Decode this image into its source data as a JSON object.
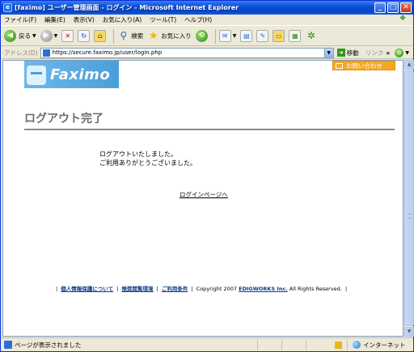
{
  "window": {
    "title": "[faximo] ユーザー管理画面 - ログイン - Microsoft Internet Explorer",
    "app_icon": "ie-icon",
    "controls": [
      "minimize",
      "maximize",
      "close"
    ]
  },
  "menu": {
    "items": [
      "ファイル(F)",
      "編集(E)",
      "表示(V)",
      "お気に入り(A)",
      "ツール(T)",
      "ヘルプ(H)"
    ]
  },
  "toolbar": {
    "back_label": "戻る",
    "search_label": "検索",
    "favorites_label": "お気に入り"
  },
  "address": {
    "label": "アドレス(D)",
    "url": "https://secure.faximo.jp/user/login.php",
    "go_label": "移動",
    "links_label": "リンク",
    "chevron": "»"
  },
  "page": {
    "logo_text": "Faximo",
    "contact_label": "お問い合わせ",
    "heading": "ログアウト完了",
    "message_line1": "ログアウトいたしました。",
    "message_line2": "ご利用ありがとうございました。",
    "login_link": "ログインページへ",
    "footer": {
      "privacy": "個人情報保護について",
      "browser": "推奨閲覧環境",
      "terms": "ご利用条件",
      "copyright_prefix": "Copyright 2007",
      "company": "EDIGWORKS Inc.",
      "copyright_suffix": "All Rights Reserved."
    }
  },
  "status": {
    "text": "ページが表示されました",
    "zone": "インターネット"
  },
  "colors": {
    "titlebar": "#0a4fd6",
    "contact_button": "#f5a623",
    "logo_bg": "#5aa9de",
    "heading": "#6c6c6c",
    "footer_link": "#0a3a8a"
  }
}
